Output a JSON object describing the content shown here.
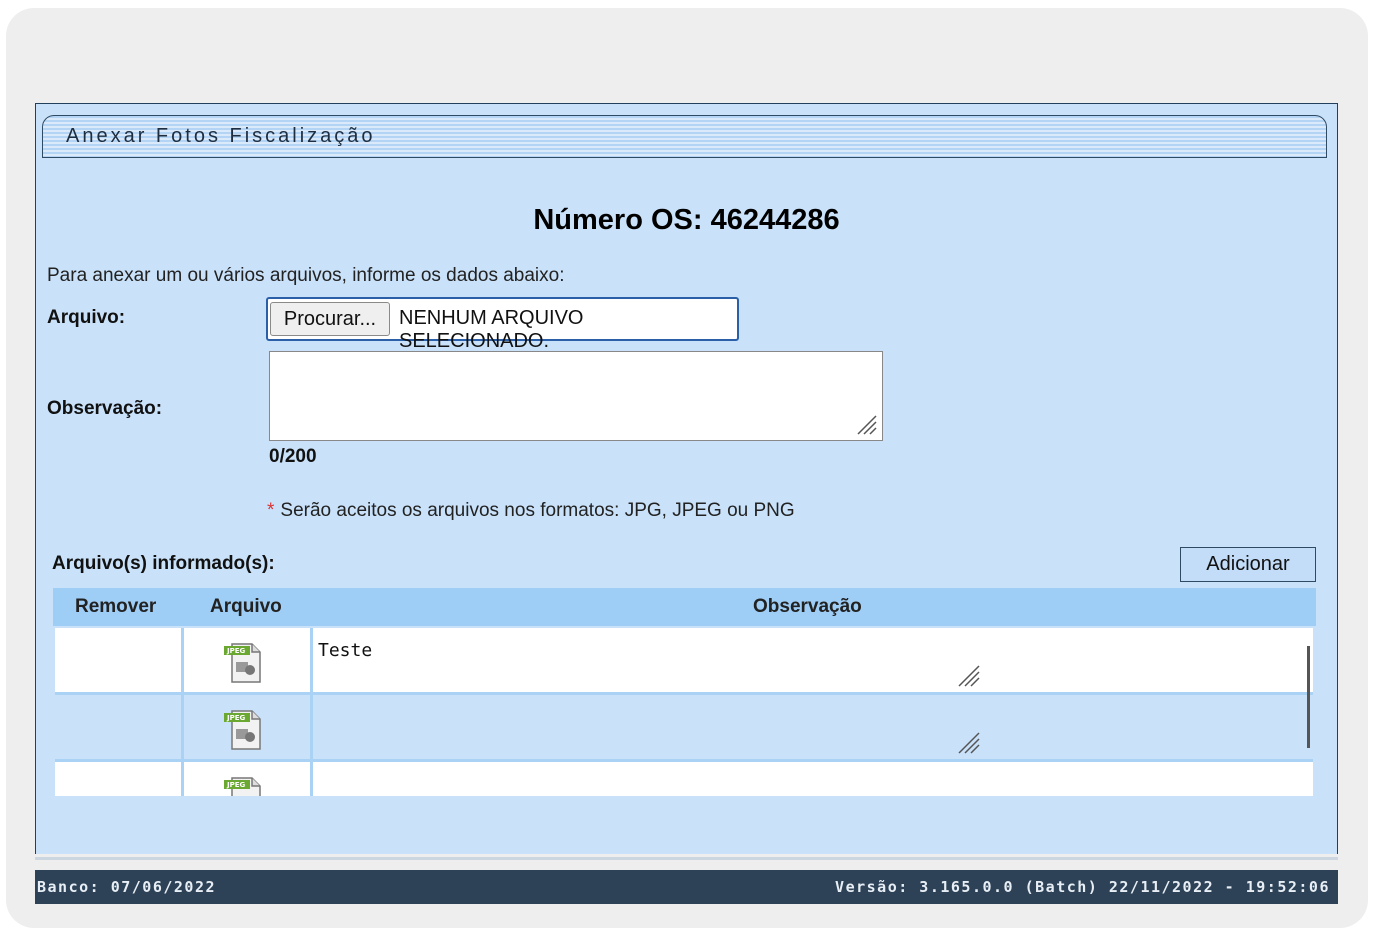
{
  "panel": {
    "title": "Anexar Fotos Fiscalização"
  },
  "form": {
    "os_title": "Número OS: 46244286",
    "intro": "Para anexar um ou vários arquivos, informe os dados abaixo:",
    "file_label": "Arquivo:",
    "file_button": "Procurar...",
    "file_status": "NENHUM ARQUIVO SELECIONADO.",
    "obs_label": "Observação:",
    "obs_value": "",
    "counter": "0/200",
    "format_star": "*",
    "format_note": "Serão aceitos os arquivos nos formatos: JPG, JPEG ou PNG"
  },
  "attachments": {
    "label": "Arquivo(s) informado(s):",
    "add_button": "Adicionar",
    "headers": [
      "Remover",
      "Arquivo",
      "Observação"
    ],
    "rows": [
      {
        "observacao": "Teste",
        "file_icon": "jpeg-file-icon"
      },
      {
        "observacao": "",
        "file_icon": "jpeg-file-icon"
      },
      {
        "observacao": "",
        "file_icon": "jpeg-file-icon"
      }
    ]
  },
  "footer": {
    "banco": "Banco: 07/06/2022",
    "versao": "Versão: 3.165.0.0 (Batch) 22/11/2022 - 19:52:06"
  },
  "colors": {
    "panel_bg": "#c9e2fa",
    "header_bg": "#9ecdf5",
    "footer_bg": "#2d4257"
  }
}
